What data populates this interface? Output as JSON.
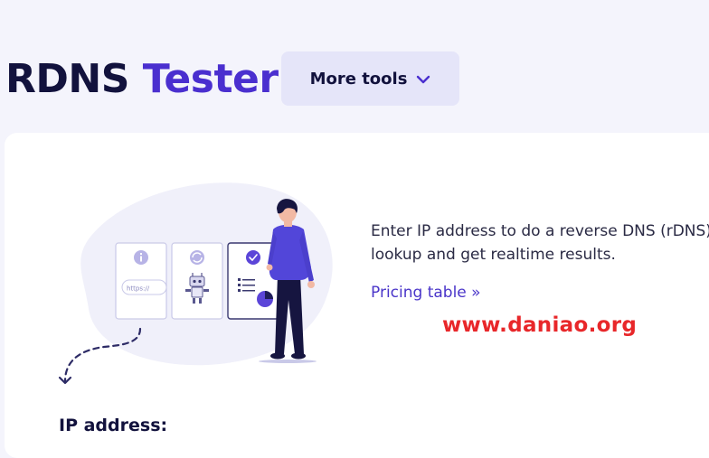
{
  "header": {
    "title_part1": "RDNS",
    "title_part2": "Tester",
    "more_tools_label": "More tools"
  },
  "main": {
    "description": "Enter IP address to do a reverse DNS (rDNS) lookup and get realtime results.",
    "pricing_link": "Pricing table »",
    "ip_label": "IP address:",
    "illustration_url_text": "https://"
  },
  "watermark": "www.daniao.org",
  "colors": {
    "title_dark": "#12123d",
    "accent": "#4a2fcf",
    "button_bg": "#e5e5f9",
    "link": "#4a35c9",
    "watermark": "#e8272a",
    "page_bg": "#f4f4fc"
  },
  "icons": [
    "chevron-down-icon",
    "info-icon",
    "refresh-icon",
    "check-icon",
    "robot-icon",
    "list-icon",
    "pie-chart-icon",
    "person-illustration",
    "dashed-arrow"
  ]
}
